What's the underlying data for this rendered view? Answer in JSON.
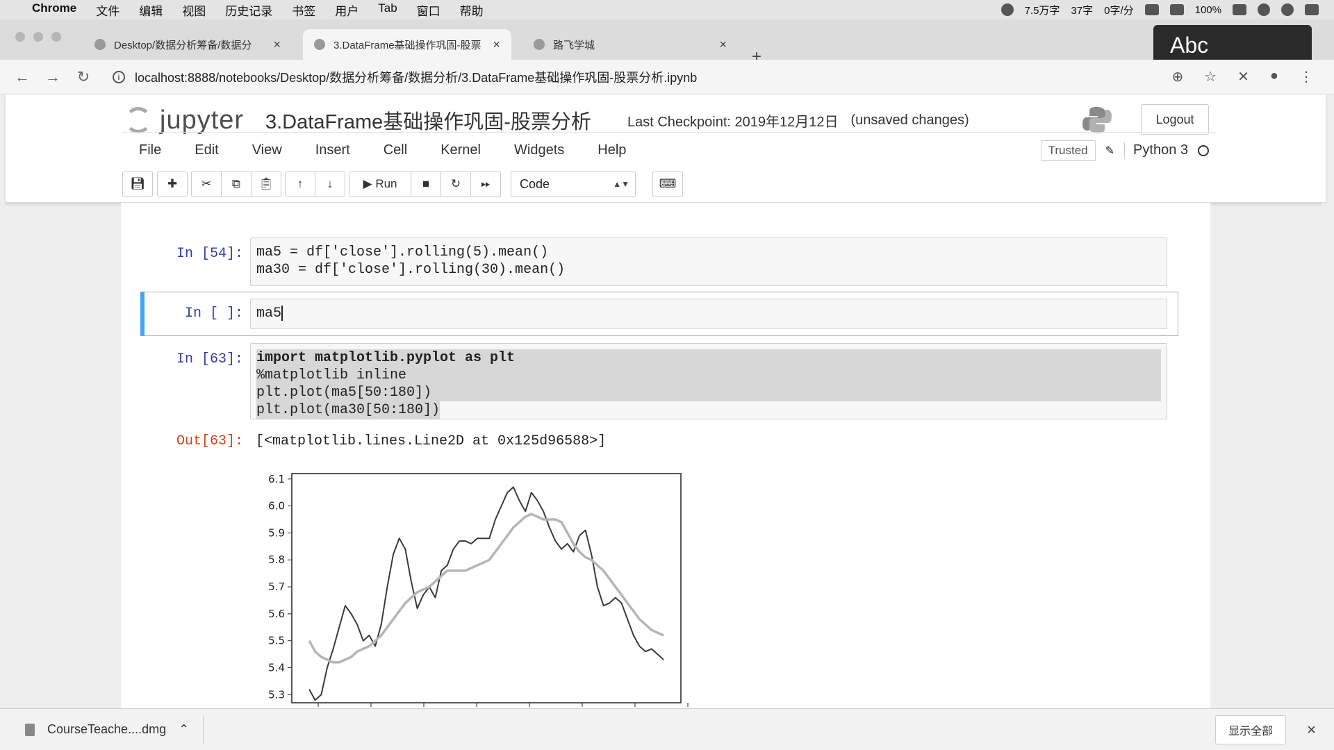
{
  "macbar": {
    "apple": "",
    "menu": [
      "Chrome",
      "文件",
      "编辑",
      "视图",
      "历史记录",
      "书签",
      "用户",
      "Tab",
      "窗口",
      "帮助"
    ],
    "status": [
      "7.5万字",
      "37字",
      "0字/分",
      "100%"
    ]
  },
  "tabs": [
    {
      "title": "Desktop/数据分析筹备/数据分",
      "close": "×"
    },
    {
      "title": "3.DataFrame基础操作巩固-股票",
      "close": "×"
    },
    {
      "title": "路飞学城",
      "close": "×"
    }
  ],
  "newtab": "+",
  "overlay": {
    "text": "Abc"
  },
  "address": {
    "url": "localhost:8888/notebooks/Desktop/数据分析筹备/数据分析/3.DataFrame基础操作巩固-股票分析.ipynb"
  },
  "header": {
    "logo": "jupyter",
    "title": "3.DataFrame基础操作巩固-股票分析",
    "checkpoint": "Last Checkpoint: 2019年12月12日",
    "unsaved": "(unsaved changes)",
    "logout": "Logout"
  },
  "menu": [
    "File",
    "Edit",
    "View",
    "Insert",
    "Cell",
    "Kernel",
    "Widgets",
    "Help"
  ],
  "trusted": "Trusted",
  "kernel": "Python 3",
  "toolbar": {
    "run": "Run",
    "celltype": "Code"
  },
  "cells": {
    "c1": {
      "prompt": "In [54]:",
      "lines": [
        "ma5 = df['close'].rolling(5).mean()",
        "ma30 = df['close'].rolling(30).mean()"
      ]
    },
    "c2": {
      "prompt": "In [ ]:",
      "code": "ma5"
    },
    "c3": {
      "prompt": "In [63]:",
      "lines": [
        "import matplotlib.pyplot as plt",
        "%matplotlib inline",
        "plt.plot(ma5[50:180])",
        "plt.plot(ma30[50:180])"
      ]
    },
    "out": {
      "prompt": "Out[63]:",
      "text": "[<matplotlib.lines.Line2D at 0x125d96588>]"
    }
  },
  "download": {
    "filename": "CourseTeache....dmg",
    "showall": "显示全部",
    "close": "×"
  },
  "chart_data": {
    "type": "line",
    "ylim": [
      5.27,
      6.12
    ],
    "yticks": [
      6.1,
      6.0,
      5.9,
      5.8,
      5.7,
      5.6,
      5.5,
      5.4,
      5.3
    ],
    "grid": false,
    "series": [
      {
        "color": "#3a3a3a",
        "values": [
          5.32,
          5.28,
          5.3,
          5.4,
          5.47,
          5.55,
          5.63,
          5.6,
          5.56,
          5.5,
          5.52,
          5.48,
          5.56,
          5.7,
          5.82,
          5.88,
          5.84,
          5.72,
          5.62,
          5.67,
          5.7,
          5.66,
          5.76,
          5.78,
          5.84,
          5.87,
          5.87,
          5.86,
          5.88,
          5.88,
          5.88,
          5.95,
          6.0,
          6.05,
          6.07,
          6.02,
          5.98,
          6.05,
          6.02,
          5.98,
          5.92,
          5.87,
          5.84,
          5.86,
          5.83,
          5.89,
          5.91,
          5.82,
          5.7,
          5.63,
          5.64,
          5.66,
          5.64,
          5.58,
          5.52,
          5.48,
          5.46,
          5.47,
          5.45,
          5.43
        ]
      },
      {
        "color": "#b5b5b5",
        "values": [
          5.5,
          5.46,
          5.44,
          5.43,
          5.42,
          5.42,
          5.43,
          5.44,
          5.46,
          5.47,
          5.48,
          5.5,
          5.52,
          5.55,
          5.58,
          5.61,
          5.64,
          5.66,
          5.68,
          5.69,
          5.7,
          5.72,
          5.74,
          5.76,
          5.76,
          5.76,
          5.76,
          5.77,
          5.78,
          5.79,
          5.8,
          5.83,
          5.86,
          5.89,
          5.92,
          5.94,
          5.96,
          5.97,
          5.96,
          5.95,
          5.95,
          5.95,
          5.94,
          5.9,
          5.86,
          5.83,
          5.81,
          5.8,
          5.78,
          5.76,
          5.73,
          5.7,
          5.67,
          5.64,
          5.61,
          5.58,
          5.56,
          5.54,
          5.53,
          5.52
        ]
      }
    ]
  }
}
